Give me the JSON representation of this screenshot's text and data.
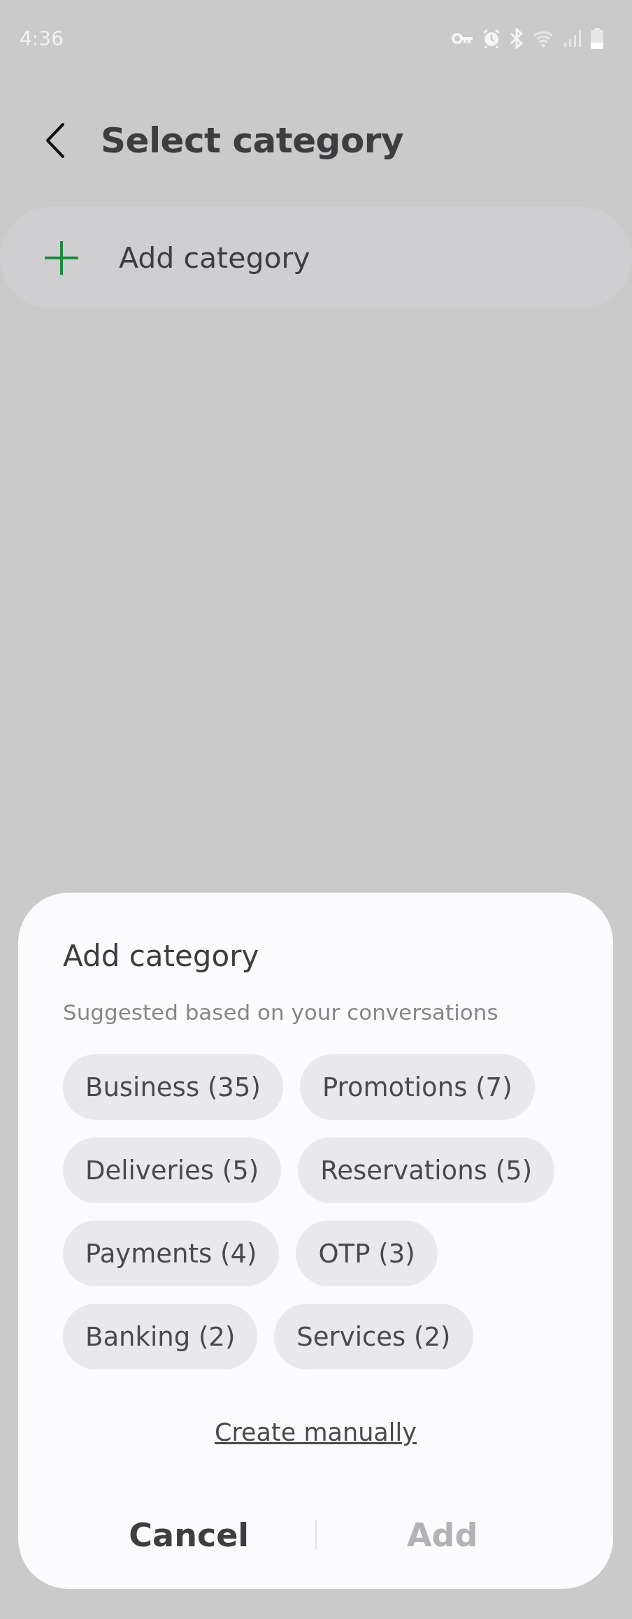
{
  "status_bar": {
    "time": "4:36"
  },
  "header": {
    "title": "Select category"
  },
  "add_row": {
    "label": "Add category"
  },
  "sheet": {
    "title": "Add category",
    "subtitle": "Suggested based on your conversations",
    "chips": [
      {
        "label": "Business (35)",
        "selected": false
      },
      {
        "label": "Promotions (7)",
        "selected": false
      },
      {
        "label": "Deliveries (5)",
        "selected": false
      },
      {
        "label": "Reservations (5)",
        "selected": false
      },
      {
        "label": "Payments (4)",
        "selected": false
      },
      {
        "label": "OTP (3)",
        "selected": false
      },
      {
        "label": "Banking (2)",
        "selected": false
      },
      {
        "label": "Services (2)",
        "selected": false
      }
    ],
    "link": "Create manually",
    "buttons": [
      {
        "label": "Cancel",
        "disabled": false
      },
      {
        "label": "Add",
        "disabled": true
      }
    ]
  }
}
